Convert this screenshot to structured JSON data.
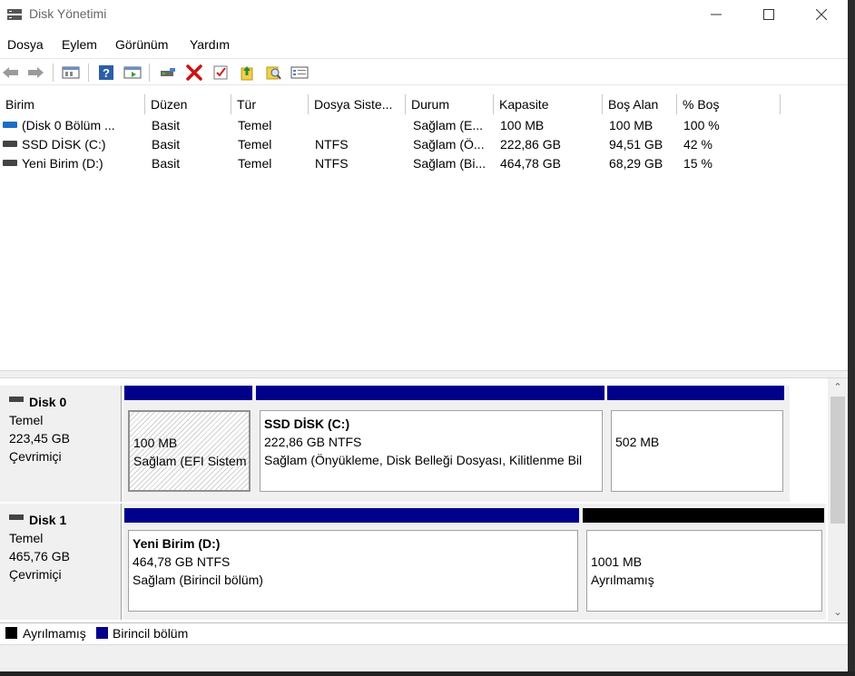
{
  "window": {
    "title": "Disk Yönetimi"
  },
  "menu": [
    "Dosya",
    "Eylem",
    "Görünüm",
    "Yardım"
  ],
  "toolbar": {
    "icons": [
      "back-arrow-icon",
      "forward-arrow-icon",
      "properties-icon",
      "help-icon",
      "show-hide-icon",
      "connect-disk-icon",
      "delete-icon",
      "check-icon",
      "import-icon",
      "search-icon",
      "list-icon"
    ]
  },
  "volume_list": {
    "headers": [
      "Birim",
      "Düzen",
      "Tür",
      "Dosya Siste...",
      "Durum",
      "Kapasite",
      "Boş Alan",
      "% Boş"
    ],
    "rows": [
      {
        "icon_color": "#1a6fc4",
        "cells": [
          "(Disk 0 Bölüm ...",
          "Basit",
          "Temel",
          "",
          "Sağlam (E...",
          "100 MB",
          "100 MB",
          "100 %"
        ]
      },
      {
        "icon_color": "#444444",
        "cells": [
          "SSD DİSK (C:)",
          "Basit",
          "Temel",
          "NTFS",
          "Sağlam (Ö...",
          "222,86 GB",
          "94,51 GB",
          "42 %"
        ]
      },
      {
        "icon_color": "#444444",
        "cells": [
          "Yeni Birim (D:)",
          "Basit",
          "Temel",
          "NTFS",
          "Sağlam (Bi...",
          "464,78 GB",
          "68,29 GB",
          "15 %"
        ]
      }
    ]
  },
  "disks": [
    {
      "name": "Disk 0",
      "type": "Temel",
      "size": "223,45 GB",
      "state": "Çevrimiçi",
      "partitions": [
        {
          "title": "",
          "line1": "100 MB",
          "line2": "Sağlam (EFI Sistem",
          "bar_color": "#00008b"
        },
        {
          "title": "SSD DİSK  (C:)",
          "line1": "222,86 GB NTFS",
          "line2": "Sağlam (Önyükleme, Disk Belleği Dosyası, Kilitlenme Bil",
          "bar_color": "#00008b"
        },
        {
          "title": "",
          "line1": "502 MB",
          "line2": "",
          "bar_color": "#00008b"
        }
      ]
    },
    {
      "name": "Disk 1",
      "type": "Temel",
      "size": "465,76 GB",
      "state": "Çevrimiçi",
      "partitions": [
        {
          "title": "Yeni Birim  (D:)",
          "line1": "464,78 GB NTFS",
          "line2": "Sağlam (Birincil bölüm)",
          "bar_color": "#00008b"
        },
        {
          "title": "",
          "line1": "1001 MB",
          "line2": "Ayrılmamış",
          "bar_color": "#000000"
        }
      ]
    }
  ],
  "legend": [
    {
      "label": "Ayrılmamış",
      "color": "#000000"
    },
    {
      "label": "Birincil bölüm",
      "color": "#00008b"
    }
  ],
  "colors": {
    "primary_partition": "#00008b",
    "unallocated": "#000000",
    "selection_hatch": "#d0d0d0"
  }
}
